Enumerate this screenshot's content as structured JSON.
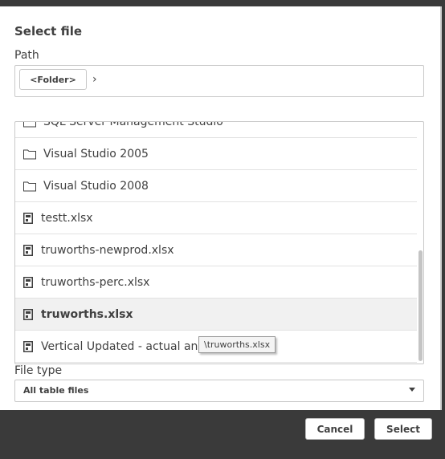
{
  "dialog": {
    "title": "Select file",
    "path_label": "Path",
    "folder_button": "<Folder>",
    "path_separator": "›"
  },
  "files": [
    {
      "name": "SQL Server Management Studio",
      "type": "folder",
      "icon": "folder-icon"
    },
    {
      "name": "Visual Studio 2005",
      "type": "folder",
      "icon": "folder-icon"
    },
    {
      "name": "Visual Studio 2008",
      "type": "folder",
      "icon": "folder-icon"
    },
    {
      "name": "testt.xlsx",
      "type": "file",
      "icon": "table-file-icon"
    },
    {
      "name": "truworths-newprod.xlsx",
      "type": "file",
      "icon": "table-file-icon"
    },
    {
      "name": "truworths-perc.xlsx",
      "type": "file",
      "icon": "table-file-icon"
    },
    {
      "name": "truworths.xlsx",
      "type": "file",
      "icon": "table-file-icon",
      "selected": true
    },
    {
      "name": "Vertical Updated - actual and Target.xlsx",
      "type": "file",
      "icon": "table-file-icon"
    }
  ],
  "tooltip": "\\truworths.xlsx",
  "file_type": {
    "label": "File type",
    "selected": "All table files"
  },
  "buttons": {
    "cancel": "Cancel",
    "select": "Select"
  },
  "colors": {
    "overlay": "#3a3a3a",
    "selected_row": "#f1f1f1",
    "text": "#404040",
    "border": "#c8c8c8"
  }
}
